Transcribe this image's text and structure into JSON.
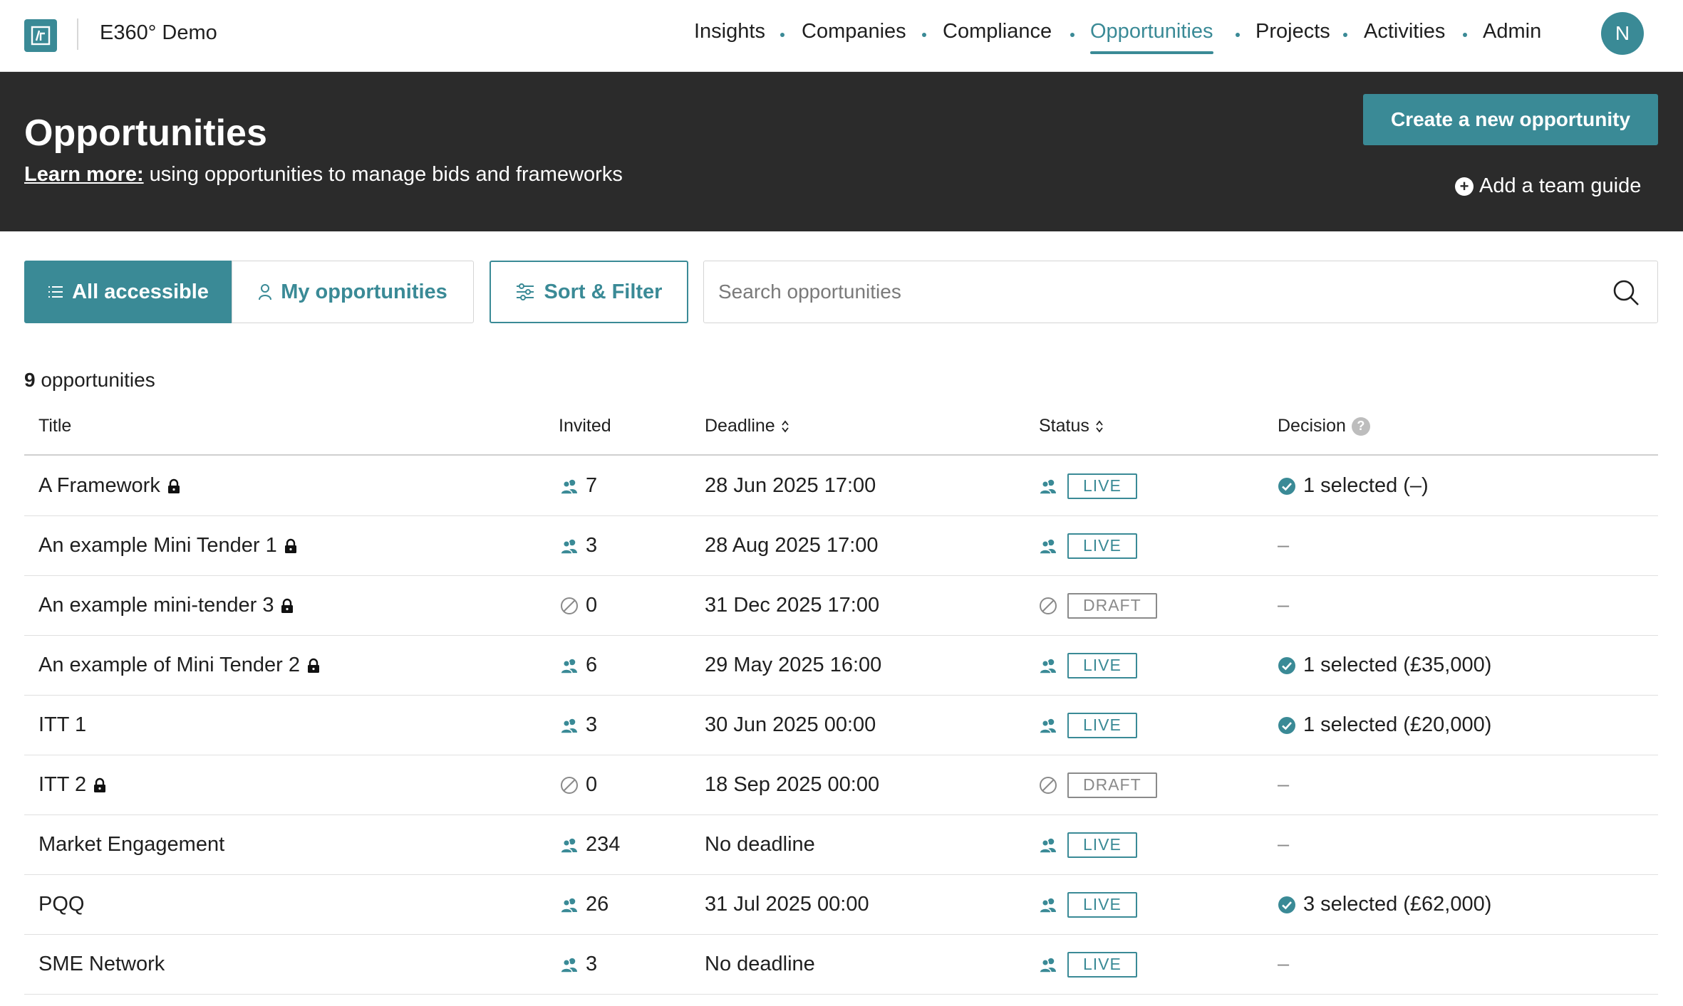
{
  "app": {
    "name": "E360° Demo",
    "avatar_initial": "N"
  },
  "nav": {
    "items": [
      {
        "label": "Insights"
      },
      {
        "label": "Companies"
      },
      {
        "label": "Compliance"
      },
      {
        "label": "Opportunities"
      },
      {
        "label": "Projects"
      },
      {
        "label": "Activities"
      },
      {
        "label": "Admin"
      }
    ],
    "active": "Opportunities"
  },
  "hero": {
    "title": "Opportunities",
    "learn_more": "Learn more:",
    "subtitle": " using opportunities to manage bids and frameworks",
    "create_button": "Create a new opportunity",
    "guide_link": "Add a team guide"
  },
  "toolbar": {
    "all_label": "All accessible",
    "mine_label": "My opportunities",
    "sort_label": "Sort & Filter",
    "search_placeholder": "Search opportunities",
    "search_value": ""
  },
  "summary": {
    "count": "9",
    "count_label": " opportunities"
  },
  "table": {
    "headers": {
      "title": "Title",
      "invited": "Invited",
      "deadline": "Deadline",
      "status": "Status",
      "decision": "Decision"
    },
    "rows": [
      {
        "title": "A Framework",
        "locked": true,
        "invited": "7",
        "deadline": "28 Jun 2025 17:00",
        "status": "LIVE",
        "decision": "1 selected (–)",
        "decided": true
      },
      {
        "title": "An example Mini Tender 1",
        "locked": true,
        "invited": "3",
        "deadline": "28 Aug 2025 17:00",
        "status": "LIVE",
        "decision": "–",
        "decided": false
      },
      {
        "title": "An example mini-tender 3",
        "locked": true,
        "invited": "0",
        "deadline": "31 Dec 2025 17:00",
        "status": "DRAFT",
        "decision": "–",
        "decided": false
      },
      {
        "title": "An example of Mini Tender 2",
        "locked": true,
        "invited": "6",
        "deadline": "29 May 2025 16:00",
        "status": "LIVE",
        "decision": "1 selected (£35,000)",
        "decided": true
      },
      {
        "title": "ITT 1",
        "locked": false,
        "invited": "3",
        "deadline": "30 Jun 2025 00:00",
        "status": "LIVE",
        "decision": "1 selected (£20,000)",
        "decided": true
      },
      {
        "title": "ITT 2",
        "locked": true,
        "invited": "0",
        "deadline": "18 Sep 2025 00:00",
        "status": "DRAFT",
        "decision": "–",
        "decided": false
      },
      {
        "title": "Market Engagement",
        "locked": false,
        "invited": "234",
        "deadline": "No deadline",
        "status": "LIVE",
        "decision": "–",
        "decided": false
      },
      {
        "title": "PQQ",
        "locked": false,
        "invited": "26",
        "deadline": "31 Jul 2025 00:00",
        "status": "LIVE",
        "decision": "3 selected (£62,000)",
        "decided": true
      },
      {
        "title": "SME Network",
        "locked": false,
        "invited": "3",
        "deadline": "No deadline",
        "status": "LIVE",
        "decision": "–",
        "decided": false
      }
    ]
  },
  "colors": {
    "accent": "#3a8a96",
    "hero_bg": "#2b2b2b",
    "draft_grey": "#8a8a8a"
  },
  "icons": {
    "logo": "company-logo-icon",
    "lock": "lock-icon",
    "people": "people-icon",
    "not_allowed": "not-allowed-icon",
    "check": "check-circle-icon",
    "search": "search-icon",
    "sliders": "sliders-icon",
    "list": "list-icon",
    "person": "person-icon",
    "plus": "plus-circle-icon",
    "sort": "sort-icon",
    "help": "help-icon"
  }
}
